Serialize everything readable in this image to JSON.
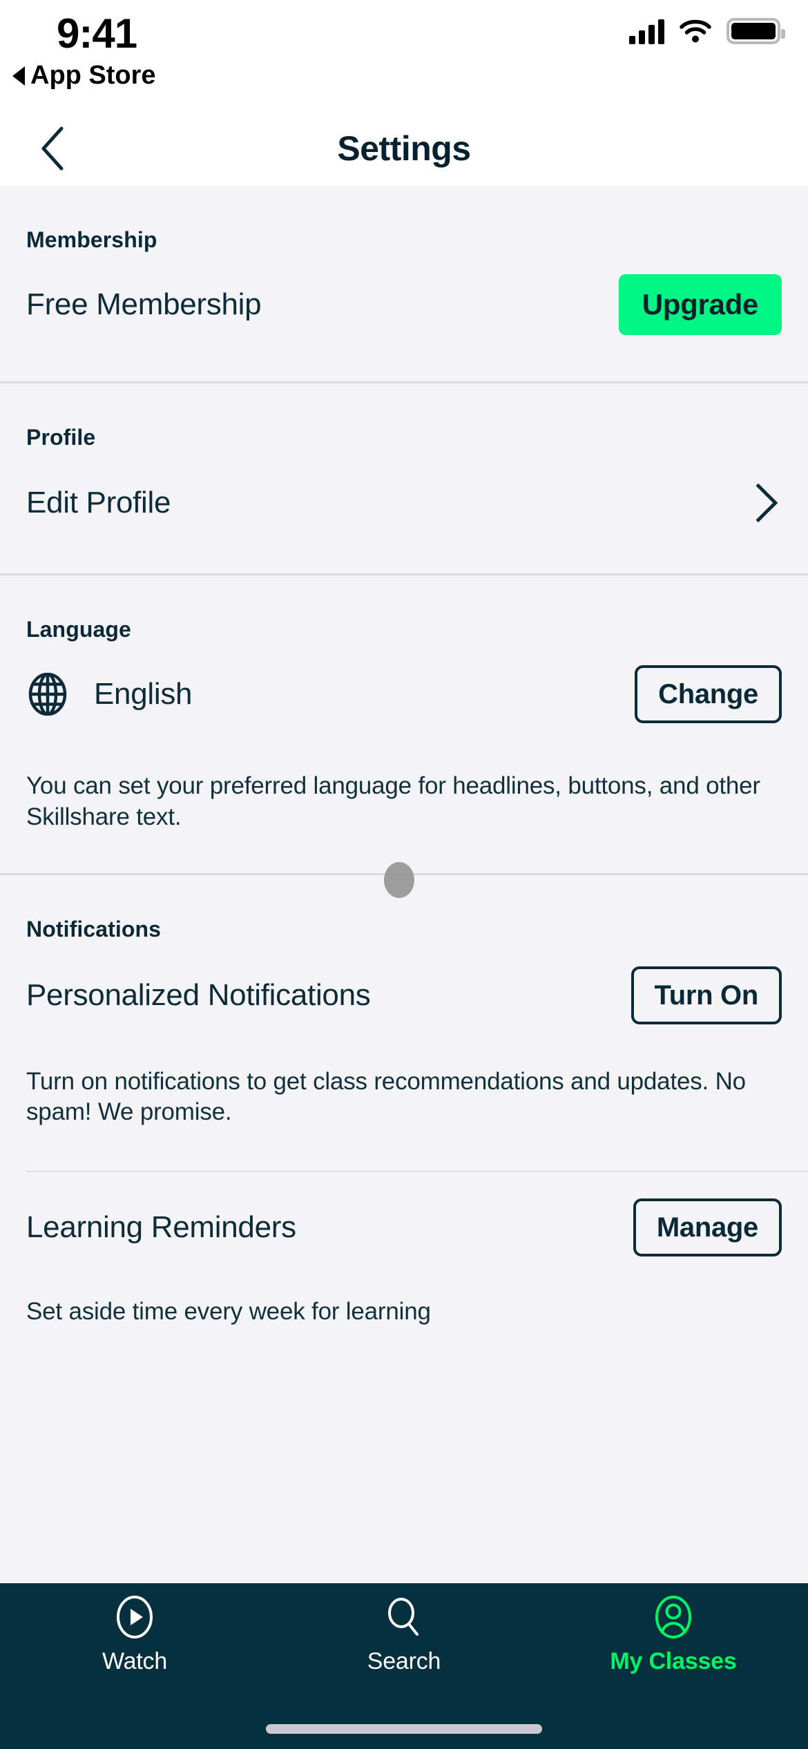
{
  "status_bar": {
    "time": "9:41",
    "back_app": "App Store",
    "signal_icon": "cellular-signal-icon",
    "wifi_icon": "wifi-icon",
    "battery_icon": "battery-icon"
  },
  "nav": {
    "title": "Settings",
    "back_icon": "chevron-left-icon"
  },
  "sections": {
    "membership": {
      "heading": "Membership",
      "row_label": "Free Membership",
      "button": "Upgrade"
    },
    "profile": {
      "heading": "Profile",
      "row_label": "Edit Profile",
      "chevron_icon": "chevron-right-icon"
    },
    "language": {
      "heading": "Language",
      "globe_icon": "globe-icon",
      "row_label": "English",
      "button": "Change",
      "description": "You can set your preferred language for headlines, buttons, and other Skillshare text."
    },
    "notifications": {
      "heading": "Notifications",
      "personalized": {
        "row_label": "Personalized Notifications",
        "button": "Turn On",
        "description": "Turn on notifications to get class recommendations and updates. No spam! We promise."
      },
      "reminders": {
        "row_label": "Learning Reminders",
        "button": "Manage",
        "description": "Set aside time every week for learning"
      }
    }
  },
  "tabbar": {
    "items": [
      {
        "label": "Watch",
        "icon": "play-circle-icon",
        "active": false
      },
      {
        "label": "Search",
        "icon": "search-icon",
        "active": false
      },
      {
        "label": "My Classes",
        "icon": "user-oval-icon",
        "active": true
      }
    ]
  },
  "colors": {
    "accent_green": "#00F584",
    "active_tab_green": "#00F564",
    "dark_navy": "#07303F",
    "page_background": "#F4F3F6"
  }
}
